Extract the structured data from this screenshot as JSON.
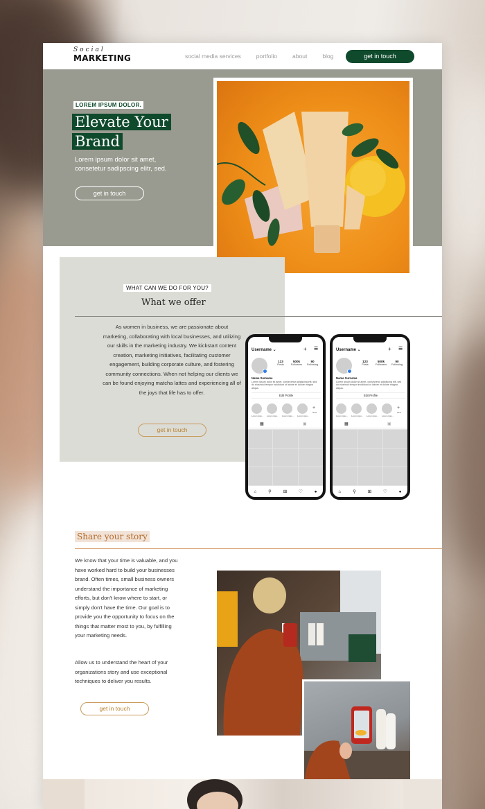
{
  "header": {
    "logo_script": "Social",
    "logo_main": "MARKETING",
    "nav": [
      "social media services",
      "portfolio",
      "about",
      "blog"
    ],
    "cta": "get in touch"
  },
  "hero": {
    "eyebrow": "LOREM IPSUM DOLOR.",
    "title_line1": "Elevate Your",
    "title_line2": "Brand",
    "description": "Lorem ipsum dolor sit amet, consetetur sadipscing elitr, sed.",
    "button": "get in touch"
  },
  "offer": {
    "eyebrow": "WHAT CAN WE DO FOR YOU?",
    "title": "What we offer",
    "body": "As women in business, we are passionate about marketing, collaborating with local businesses, and utilizing our skills in the marketing industry. We kickstart content creation, marketing initiatives, facilitating customer engagement, building corporate culture, and fostering community connections.  When not helping our clients we can be found enjoying matcha lattes and experiencing all of the joys that life has to offer.",
    "button": "get in touch"
  },
  "phone": {
    "username": "Username ⌄",
    "stats": [
      {
        "value": "123",
        "label": "Posts"
      },
      {
        "value": "500k",
        "label": "Followers"
      },
      {
        "value": "90",
        "label": "Following"
      }
    ],
    "name": "Name Surname",
    "bio": "Lorem ipsum dolor sit amet, consectetur adipiscing elit, sed do eiusmod tempor incididunt ut labore et dolore magna aliqua.",
    "edit_profile": "Edit Profile",
    "story_label": "Lorem ipsu...",
    "new_label": "New"
  },
  "story": {
    "title": "Share your story",
    "paragraph1": "We know that your time is valuable, and you have worked hard to build your businesses brand. Often times, small business owners understand the importance of marketing efforts, but don't know where to start, or simply don't have the time. Our goal is to provide you the opportunity to focus on the things that matter most to you, by fulfilling your marketing needs.",
    "paragraph2": "Allow us to understand the heart of your organizations story and use exceptional techniques to deliver you results.",
    "button": "get in touch"
  },
  "colors": {
    "brand_green": "#0f4a2c",
    "hero_gray": "#9a9b90",
    "offer_gray": "#dcdcd6",
    "accent_orange": "#b36a2a"
  }
}
